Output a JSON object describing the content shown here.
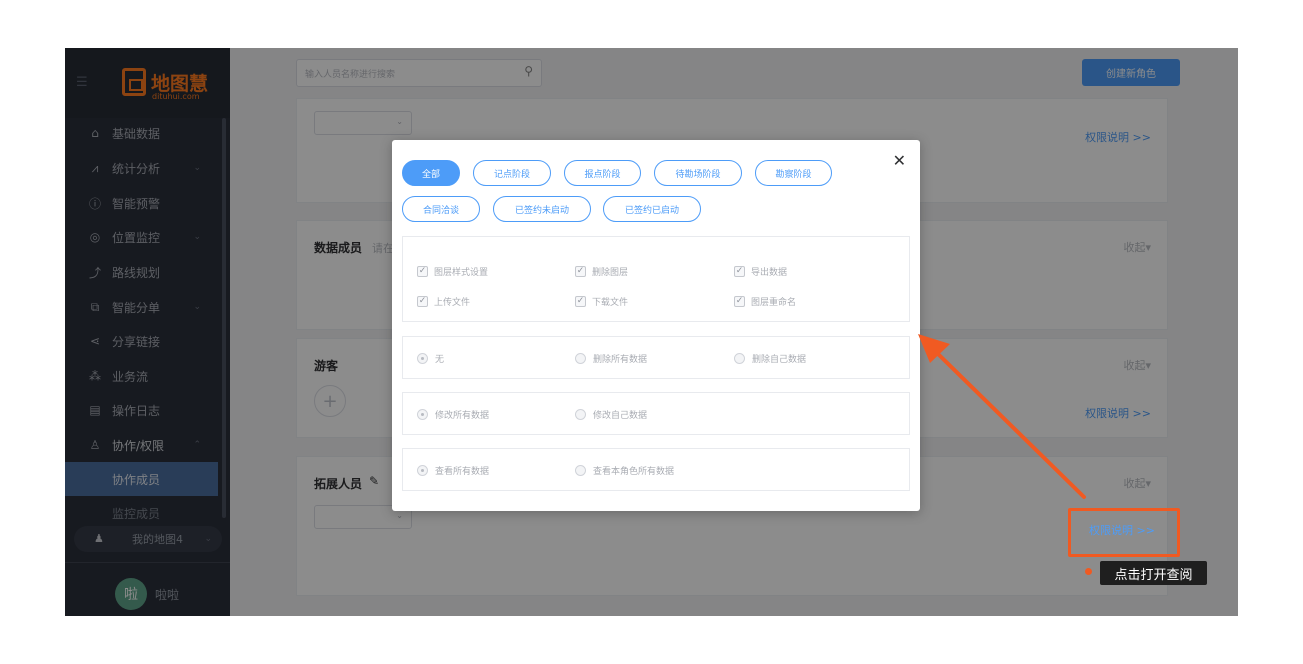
{
  "sidebar": {
    "logo_text": "地图慧",
    "logo_sub": "dituhui.com",
    "items": [
      {
        "label": "基础数据",
        "icon": "home-icon",
        "glyph": "⌂",
        "has_chevron": false
      },
      {
        "label": "统计分析",
        "icon": "trend-icon",
        "glyph": "⩘",
        "has_chevron": true
      },
      {
        "label": "智能预警",
        "icon": "info-icon",
        "glyph": "ⓘ",
        "has_chevron": false
      },
      {
        "label": "位置监控",
        "icon": "location-icon",
        "glyph": "◎",
        "has_chevron": true
      },
      {
        "label": "路线规划",
        "icon": "route-icon",
        "glyph": "⤴",
        "has_chevron": false
      },
      {
        "label": "智能分单",
        "icon": "split-icon",
        "glyph": "⧉",
        "has_chevron": true
      },
      {
        "label": "分享链接",
        "icon": "share-icon",
        "glyph": "⋖",
        "has_chevron": false
      },
      {
        "label": "业务流",
        "icon": "flow-icon",
        "glyph": "⁂",
        "has_chevron": false
      },
      {
        "label": "操作日志",
        "icon": "log-icon",
        "glyph": "▤",
        "has_chevron": false
      },
      {
        "label": "协作/权限",
        "icon": "user-icon",
        "glyph": "♙",
        "has_chevron": true
      }
    ],
    "sub_items": [
      "协作成员",
      "监控成员"
    ],
    "map_select": "我的地图4",
    "user_avatar": "啦",
    "user_name": "啦啦"
  },
  "header": {
    "search_placeholder": "输入人员名称进行搜索",
    "create_button": "创建新角色"
  },
  "cards": {
    "perm_link": "权限说明 >>",
    "data_members_title": "数据成员",
    "data_members_hint": "请在",
    "collapse": "收起",
    "guest_title": "游客",
    "expand_title": "拓展人员"
  },
  "modal": {
    "tags_row1": [
      "全部",
      "记点阶段",
      "报点阶段",
      "待勘场阶段",
      "勘察阶段"
    ],
    "tags_row2": [
      "合同洽谈",
      "已签约未启动",
      "已签约已启动"
    ],
    "checkboxes": [
      "图层样式设置",
      "删除图层",
      "导出数据",
      "上传文件",
      "下载文件",
      "图层重命名"
    ],
    "radio_group_1": [
      "无",
      "删除所有数据",
      "删除自己数据"
    ],
    "radio_group_2": [
      "修改所有数据",
      "修改自己数据"
    ],
    "radio_group_3": [
      "查看所有数据",
      "查看本角色所有数据"
    ]
  },
  "annotation": {
    "link": "权限说明 >>",
    "tooltip": "点击打开查阅",
    "color": "#f05a22"
  }
}
